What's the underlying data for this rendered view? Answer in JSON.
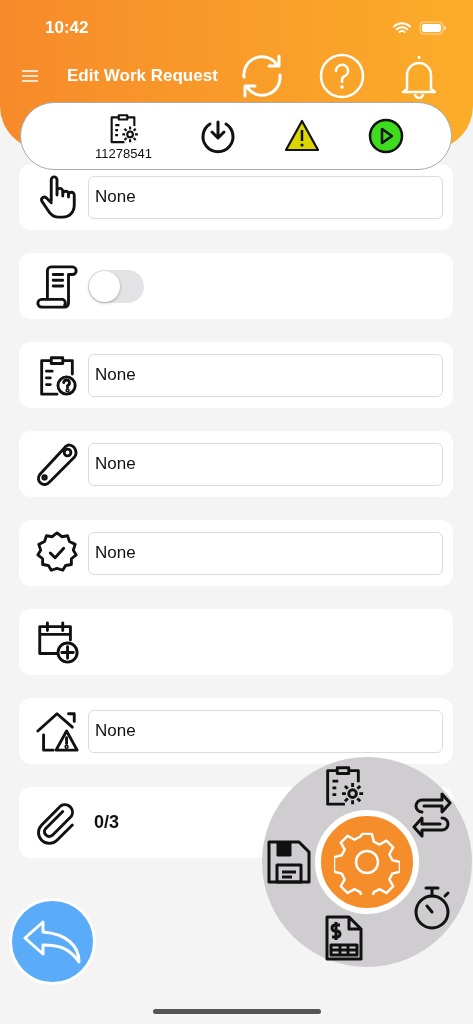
{
  "status_bar": {
    "time": "10:42"
  },
  "header": {
    "title": "Edit Work Request"
  },
  "toolbar": {
    "work_order": "11278541"
  },
  "rows": [
    {
      "kind": "field",
      "value": "None"
    },
    {
      "kind": "toggle",
      "on": false
    },
    {
      "kind": "field",
      "value": "None"
    },
    {
      "kind": "field",
      "value": "None"
    },
    {
      "kind": "field",
      "value": "None"
    },
    {
      "kind": "empty"
    },
    {
      "kind": "field",
      "value": "None"
    },
    {
      "kind": "attachments",
      "count": "0/3"
    }
  ]
}
